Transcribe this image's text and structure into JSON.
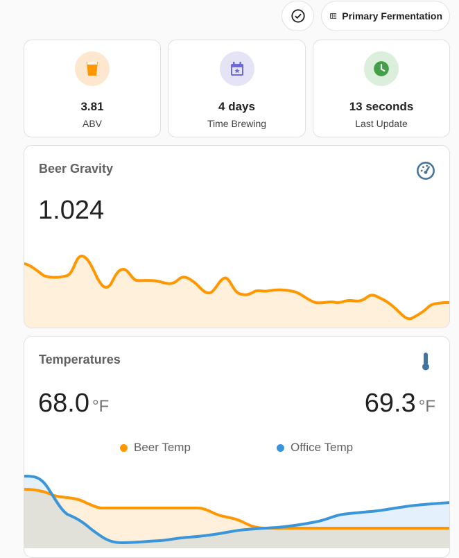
{
  "header": {
    "check_icon": "check-circle-icon",
    "phase_icon": "hydrometer-icon",
    "phase_label": "Primary Fermentation"
  },
  "stats": [
    {
      "id": "abv",
      "icon": "beer-glass-icon",
      "value": "3.81",
      "label": "ABV",
      "color": "#ff9800",
      "bg": "#fde7cf"
    },
    {
      "id": "time",
      "icon": "calendar-star-icon",
      "value": "4 days",
      "label": "Time Brewing",
      "color": "#6f6bd6",
      "bg": "#e5e4f6"
    },
    {
      "id": "update",
      "icon": "clock-icon",
      "value": "13 seconds",
      "label": "Last Update",
      "color": "#43a047",
      "bg": "#dcefdd"
    }
  ],
  "gravity": {
    "title": "Beer Gravity",
    "icon": "gauge-icon",
    "value": "1.024",
    "color": "#ff9800",
    "fill": "#fff0dc"
  },
  "temperatures": {
    "title": "Temperatures",
    "icon": "thermometer-icon",
    "beer_value": "68.0",
    "beer_unit": "°F",
    "office_value": "69.3",
    "office_unit": "°F",
    "legend": [
      {
        "name": "Beer Temp",
        "color": "#ff9800"
      },
      {
        "name": "Office Temp",
        "color": "#3a96d9"
      }
    ]
  }
}
